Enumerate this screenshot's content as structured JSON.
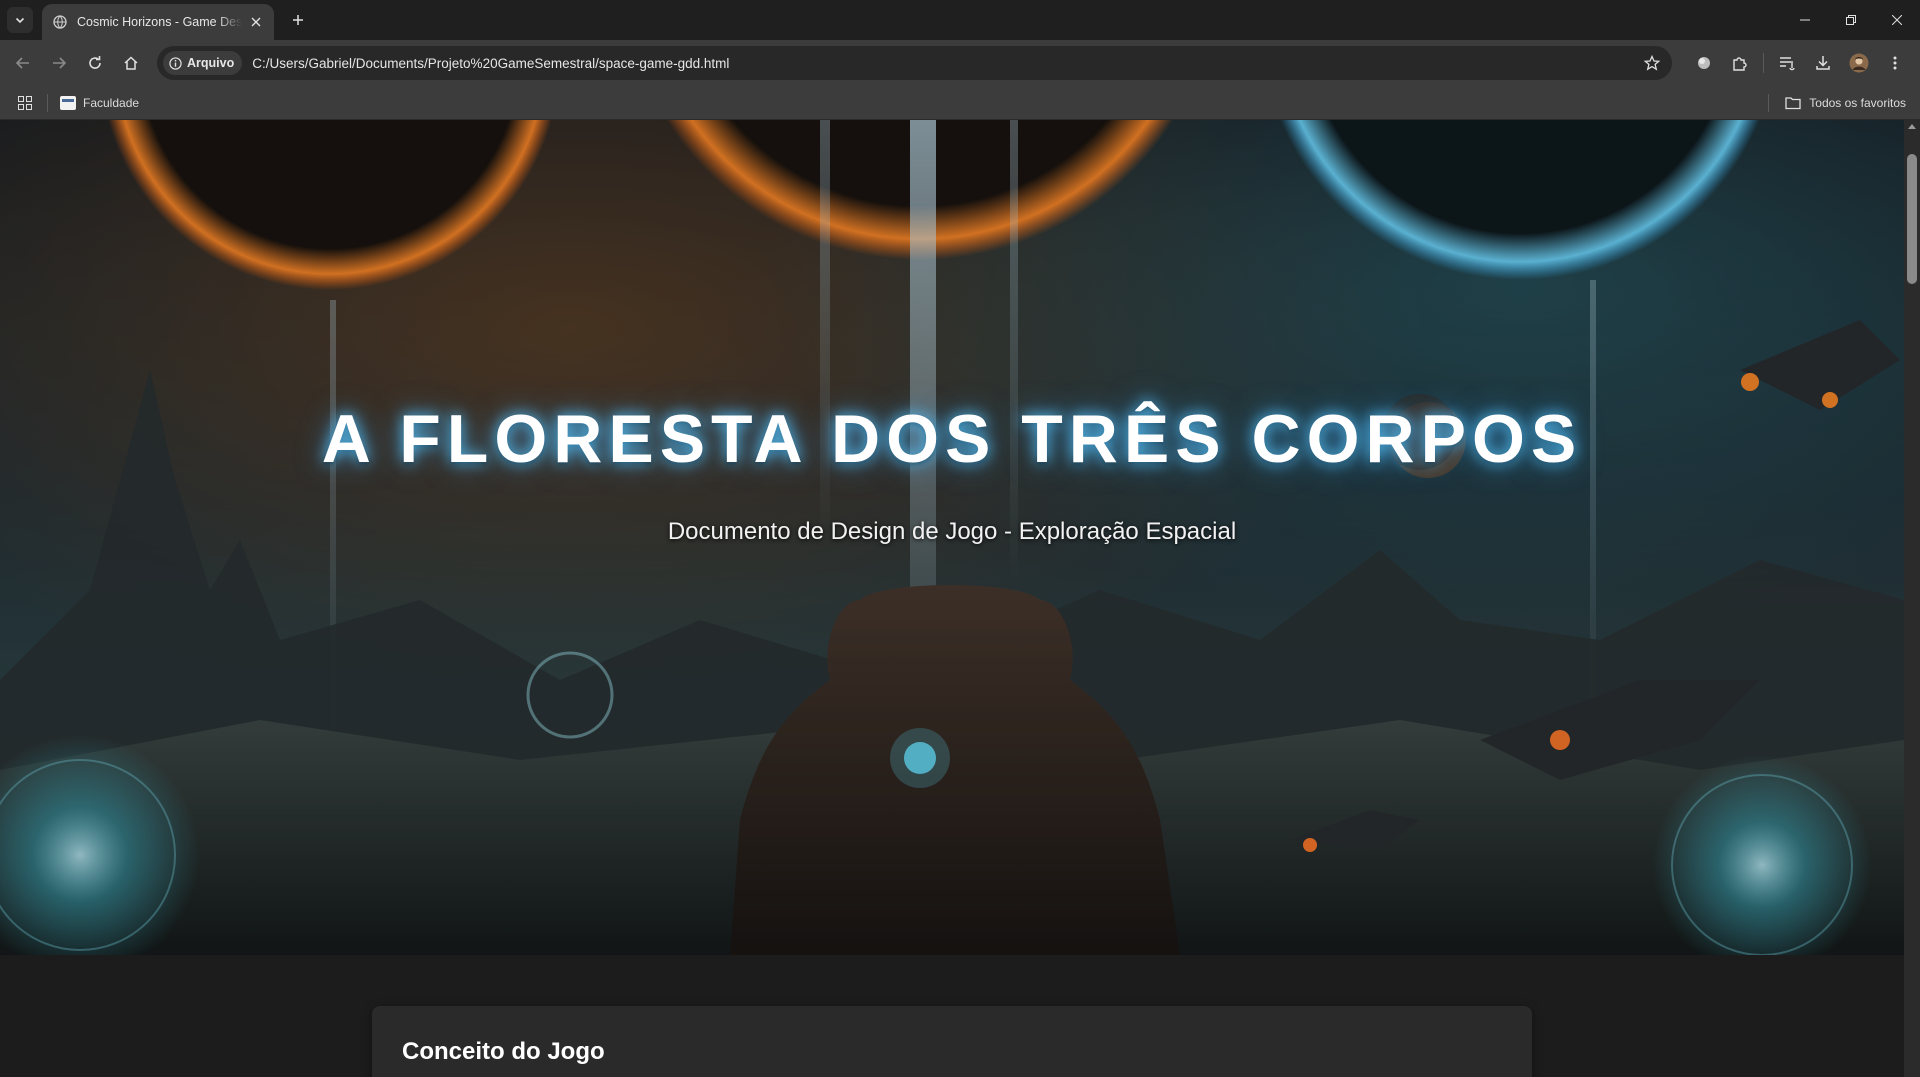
{
  "browser": {
    "tab": {
      "title": "Cosmic Horizons - Game Design Document"
    },
    "omnibox": {
      "chip_label": "Arquivo",
      "url": "C:/Users/Gabriel/Documents/Projeto%20GameSemestral/space-game-gdd.html"
    },
    "bookmarks": {
      "items": [
        {
          "label": "Faculdade"
        }
      ],
      "all_bookmarks_label": "Todos os favoritos"
    }
  },
  "page": {
    "hero": {
      "title": "A FLORESTA DOS TRÊS CORPOS",
      "subtitle": "Documento de Design de Jogo - Exploração Espacial"
    },
    "sections": [
      {
        "title": "Conceito do Jogo"
      }
    ]
  }
}
